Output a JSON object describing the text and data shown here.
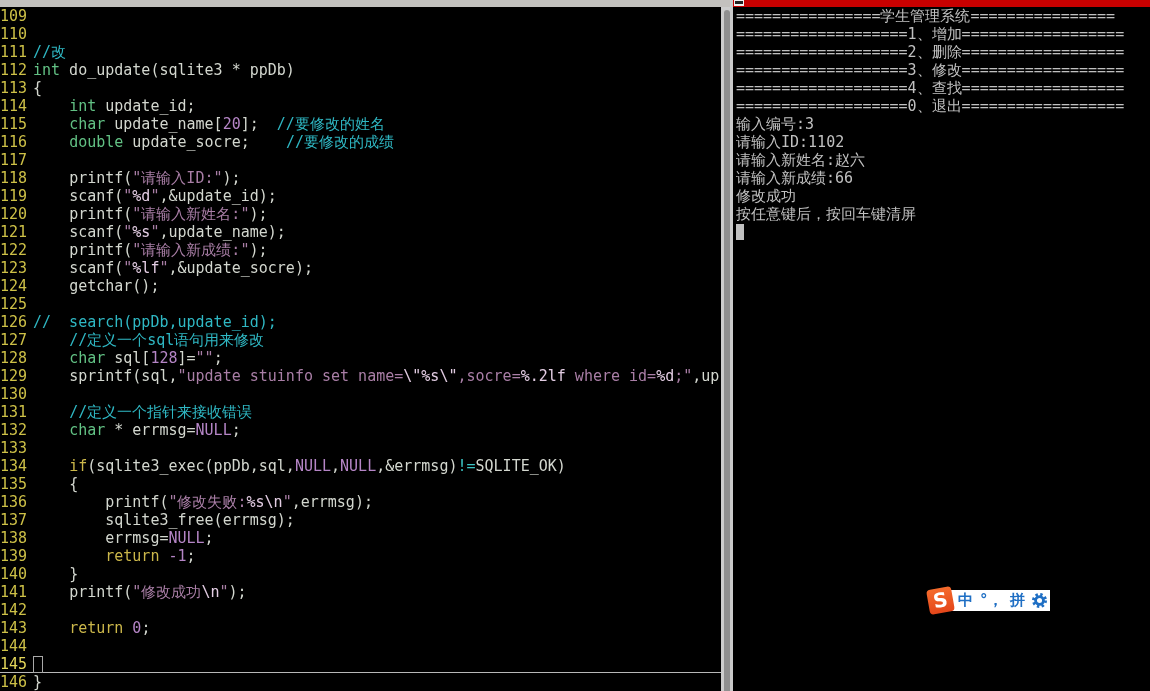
{
  "editor": {
    "lines": [
      {
        "number": "109",
        "current": false
      },
      {
        "number": "110",
        "current": false
      },
      {
        "number": "111",
        "current": false,
        "segments": [
          {
            "text": "//改",
            "kind": "comment"
          }
        ]
      },
      {
        "number": "112",
        "current": false,
        "segments": [
          {
            "text": "int",
            "kind": "type"
          },
          {
            "text": " do_update(sqlite3 * ppDb)",
            "kind": "plain"
          }
        ]
      },
      {
        "number": "113",
        "current": false,
        "segments": [
          {
            "text": "{",
            "kind": "plain"
          }
        ]
      },
      {
        "number": "114",
        "current": false,
        "segments": [
          {
            "text": "    int",
            "kind": "type"
          },
          {
            "text": " update_id;",
            "kind": "plain"
          }
        ]
      },
      {
        "number": "115",
        "current": false,
        "segments": [
          {
            "text": "    char",
            "kind": "type"
          },
          {
            "text": " update_name[",
            "kind": "plain"
          },
          {
            "text": "20",
            "kind": "constant"
          },
          {
            "text": "];  ",
            "kind": "plain"
          },
          {
            "text": "//要修改的姓名",
            "kind": "comment"
          }
        ]
      },
      {
        "number": "116",
        "current": false,
        "segments": [
          {
            "text": "    double",
            "kind": "type"
          },
          {
            "text": " update_socre;    ",
            "kind": "plain"
          },
          {
            "text": "//要修改的成绩",
            "kind": "comment"
          }
        ]
      },
      {
        "number": "117",
        "current": false
      },
      {
        "number": "118",
        "current": false,
        "segments": [
          {
            "text": "    printf(",
            "kind": "plain"
          },
          {
            "text": "\"请输入ID:\"",
            "kind": "string"
          },
          {
            "text": ");",
            "kind": "plain"
          }
        ]
      },
      {
        "number": "119",
        "current": false,
        "segments": [
          {
            "text": "    scanf(",
            "kind": "plain"
          },
          {
            "text": "\"",
            "kind": "string"
          },
          {
            "text": "%d",
            "kind": "special"
          },
          {
            "text": "\"",
            "kind": "string"
          },
          {
            "text": ",&update_id);",
            "kind": "plain"
          }
        ]
      },
      {
        "number": "120",
        "current": false,
        "segments": [
          {
            "text": "    printf(",
            "kind": "plain"
          },
          {
            "text": "\"请输入新姓名:\"",
            "kind": "string"
          },
          {
            "text": ");",
            "kind": "plain"
          }
        ]
      },
      {
        "number": "121",
        "current": false,
        "segments": [
          {
            "text": "    scanf(",
            "kind": "plain"
          },
          {
            "text": "\"",
            "kind": "string"
          },
          {
            "text": "%s",
            "kind": "special"
          },
          {
            "text": "\"",
            "kind": "string"
          },
          {
            "text": ",update_name);",
            "kind": "plain"
          }
        ]
      },
      {
        "number": "122",
        "current": false,
        "segments": [
          {
            "text": "    printf(",
            "kind": "plain"
          },
          {
            "text": "\"请输入新成绩:\"",
            "kind": "string"
          },
          {
            "text": ");",
            "kind": "plain"
          }
        ]
      },
      {
        "number": "123",
        "current": false,
        "segments": [
          {
            "text": "    scanf(",
            "kind": "plain"
          },
          {
            "text": "\"",
            "kind": "string"
          },
          {
            "text": "%lf",
            "kind": "special"
          },
          {
            "text": "\"",
            "kind": "string"
          },
          {
            "text": ",&update_socre);",
            "kind": "plain"
          }
        ]
      },
      {
        "number": "124",
        "current": false,
        "segments": [
          {
            "text": "    getchar();",
            "kind": "plain"
          }
        ]
      },
      {
        "number": "125",
        "current": false
      },
      {
        "number": "126",
        "current": false,
        "segments": [
          {
            "text": "//  search(ppDb,update_id);",
            "kind": "comment"
          }
        ]
      },
      {
        "number": "127",
        "current": false,
        "segments": [
          {
            "text": "    //定义一个sql语句用来修改",
            "kind": "comment"
          }
        ]
      },
      {
        "number": "128",
        "current": false,
        "segments": [
          {
            "text": "    char",
            "kind": "type"
          },
          {
            "text": " sql[",
            "kind": "plain"
          },
          {
            "text": "128",
            "kind": "constant"
          },
          {
            "text": "]=",
            "kind": "plain"
          },
          {
            "text": "\"\"",
            "kind": "string"
          },
          {
            "text": ";",
            "kind": "plain"
          }
        ]
      },
      {
        "number": "129",
        "current": false,
        "segments": [
          {
            "text": "    sprintf(sql,",
            "kind": "plain"
          },
          {
            "text": "\"update stuinfo set name=",
            "kind": "string"
          },
          {
            "text": "\\\"%s\\\"",
            "kind": "special"
          },
          {
            "text": ",socre=",
            "kind": "string"
          },
          {
            "text": "%.2lf",
            "kind": "special"
          },
          {
            "text": " where id=",
            "kind": "string"
          },
          {
            "text": "%d",
            "kind": "special"
          },
          {
            "text": ";\"",
            "kind": "string"
          },
          {
            "text": ",up",
            "kind": "plain"
          }
        ]
      },
      {
        "number": "130",
        "current": false
      },
      {
        "number": "131",
        "current": false,
        "segments": [
          {
            "text": "    //定义一个指针来接收错误",
            "kind": "comment"
          }
        ]
      },
      {
        "number": "132",
        "current": false,
        "segments": [
          {
            "text": "    char",
            "kind": "type"
          },
          {
            "text": " * errmsg=",
            "kind": "plain"
          },
          {
            "text": "NULL",
            "kind": "constant"
          },
          {
            "text": ";",
            "kind": "plain"
          }
        ]
      },
      {
        "number": "133",
        "current": false
      },
      {
        "number": "134",
        "current": false,
        "segments": [
          {
            "text": "    if",
            "kind": "statement"
          },
          {
            "text": "(sqlite3_exec(ppDb,sql,",
            "kind": "plain"
          },
          {
            "text": "NULL",
            "kind": "constant"
          },
          {
            "text": ",",
            "kind": "plain"
          },
          {
            "text": "NULL",
            "kind": "constant"
          },
          {
            "text": ",&errmsg)",
            "kind": "plain"
          },
          {
            "text": "!=",
            "kind": "operator"
          },
          {
            "text": "SQLITE_OK)",
            "kind": "plain"
          }
        ]
      },
      {
        "number": "135",
        "current": false,
        "segments": [
          {
            "text": "    {",
            "kind": "plain"
          }
        ]
      },
      {
        "number": "136",
        "current": false,
        "segments": [
          {
            "text": "        printf(",
            "kind": "plain"
          },
          {
            "text": "\"修改失败:",
            "kind": "string"
          },
          {
            "text": "%s\\n",
            "kind": "special"
          },
          {
            "text": "\"",
            "kind": "string"
          },
          {
            "text": ",errmsg);",
            "kind": "plain"
          }
        ]
      },
      {
        "number": "137",
        "current": false,
        "segments": [
          {
            "text": "        sqlite3_free(errmsg);",
            "kind": "plain"
          }
        ]
      },
      {
        "number": "138",
        "current": false,
        "segments": [
          {
            "text": "        errmsg=",
            "kind": "plain"
          },
          {
            "text": "NULL",
            "kind": "constant"
          },
          {
            "text": ";",
            "kind": "plain"
          }
        ]
      },
      {
        "number": "139",
        "current": false,
        "segments": [
          {
            "text": "        return",
            "kind": "statement"
          },
          {
            "text": " -1",
            "kind": "constant"
          },
          {
            "text": ";",
            "kind": "plain"
          }
        ]
      },
      {
        "number": "140",
        "current": false,
        "segments": [
          {
            "text": "    }",
            "kind": "plain"
          }
        ]
      },
      {
        "number": "141",
        "current": false,
        "segments": [
          {
            "text": "    printf(",
            "kind": "plain"
          },
          {
            "text": "\"修改成功",
            "kind": "string"
          },
          {
            "text": "\\n",
            "kind": "special"
          },
          {
            "text": "\"",
            "kind": "string"
          },
          {
            "text": ");",
            "kind": "plain"
          }
        ]
      },
      {
        "number": "142",
        "current": false
      },
      {
        "number": "143",
        "current": false,
        "segments": [
          {
            "text": "    return",
            "kind": "statement"
          },
          {
            "text": " 0",
            "kind": "constant"
          },
          {
            "text": ";",
            "kind": "plain"
          }
        ]
      },
      {
        "number": "144",
        "current": false
      },
      {
        "number": "145",
        "current": true
      },
      {
        "number": "146",
        "current": false,
        "segments": [
          {
            "text": "}",
            "kind": "plain"
          }
        ]
      }
    ]
  },
  "terminal": {
    "lines": [
      "================学生管理系统================",
      "===================1、增加==================",
      "===================2、删除==================",
      "===================3、修改==================",
      "===================4、查找==================",
      "===================0、退出==================",
      "输入编号:3",
      "请输入ID:1102",
      "请输入新姓名:赵六",
      "请输入新成绩:66",
      "修改成功",
      "按任意键后，按回车键清屏"
    ]
  },
  "ime_toolbar": {
    "logo": "S",
    "buttons": [
      "中",
      "°，",
      "拼"
    ]
  }
}
